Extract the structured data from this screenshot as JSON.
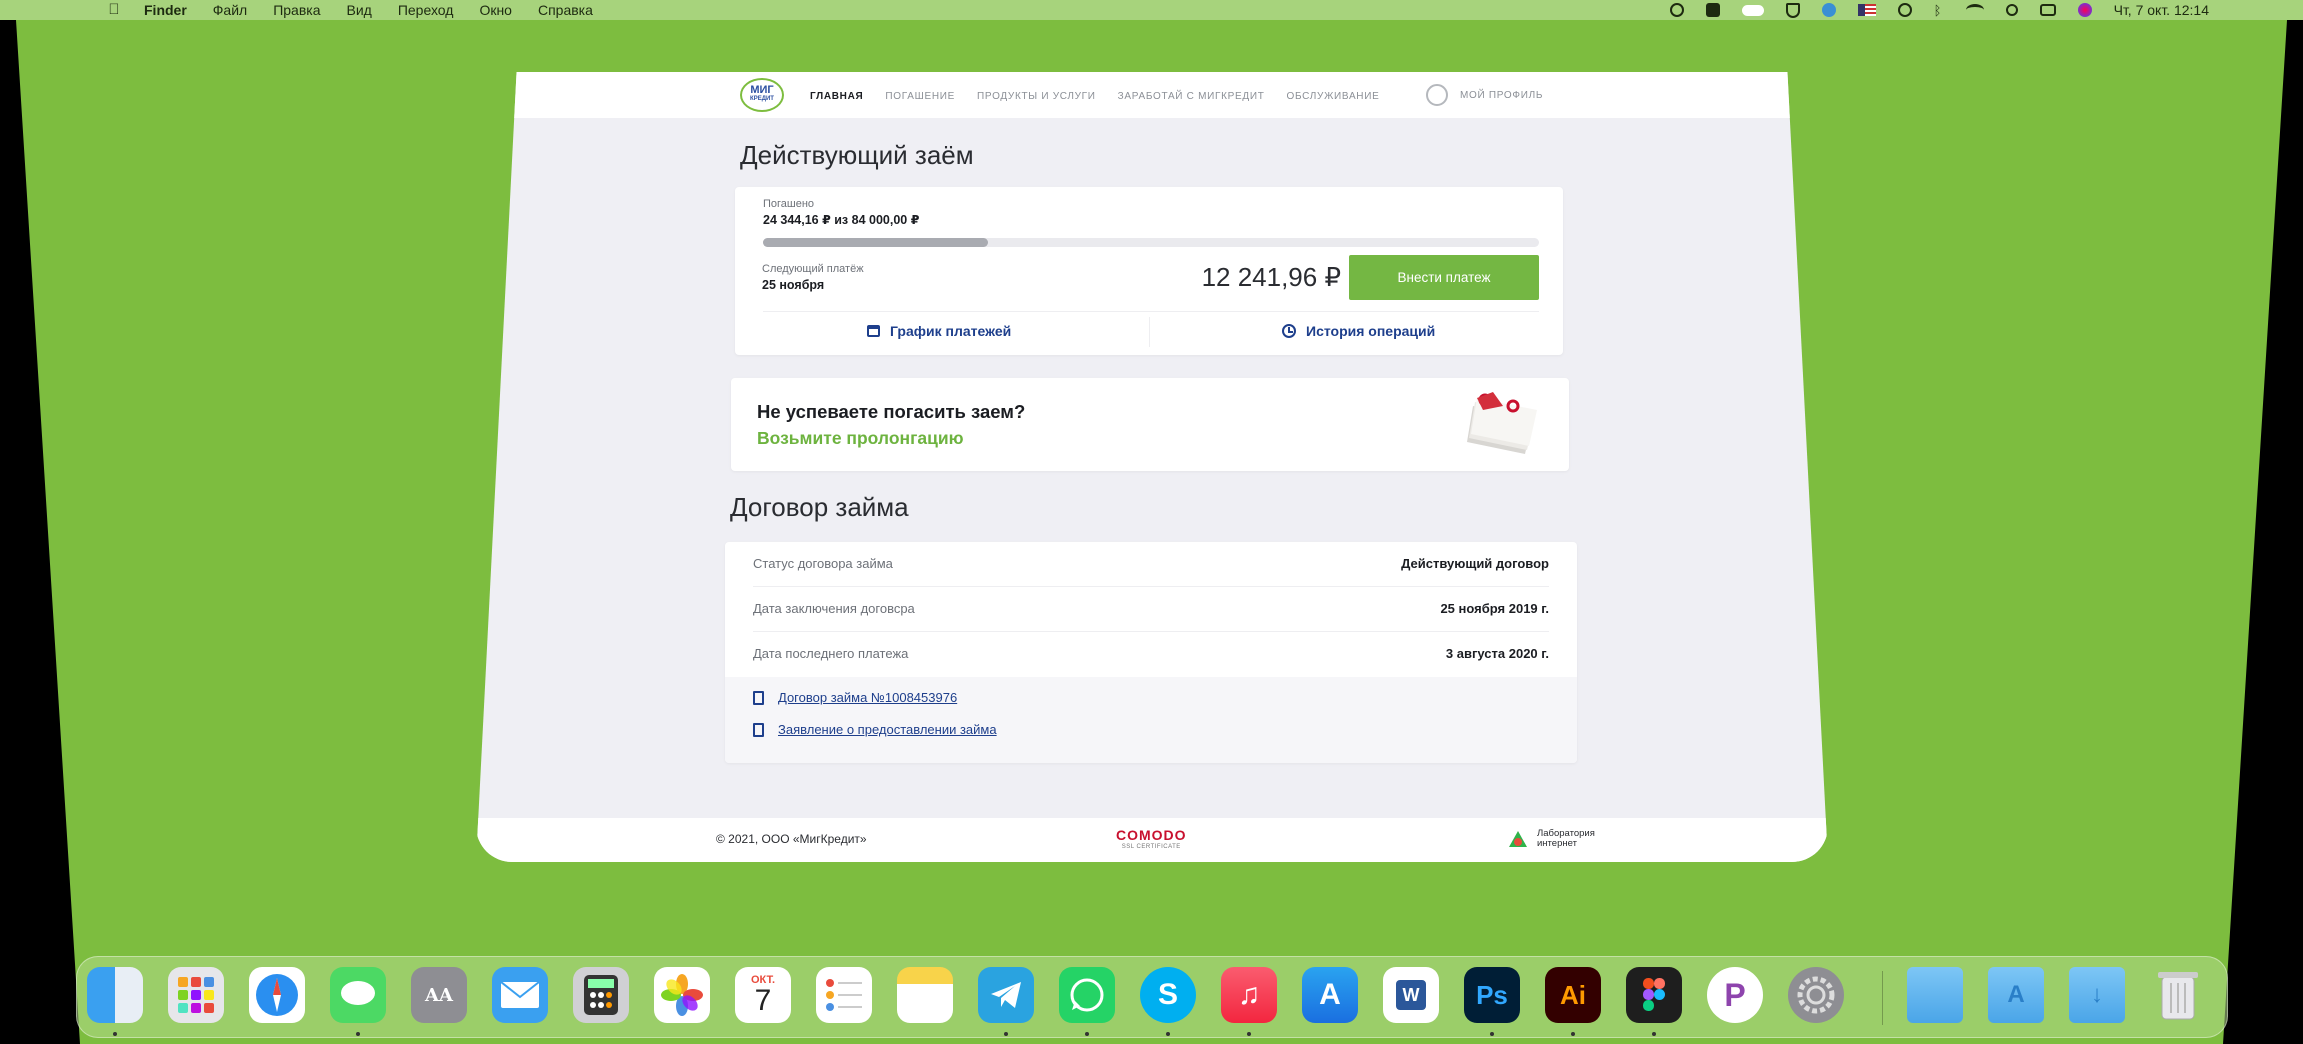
{
  "menubar": {
    "app": "Finder",
    "items": [
      "Файл",
      "Правка",
      "Вид",
      "Переход",
      "Окно",
      "Справка"
    ],
    "clock": "Чт, 7 окт.  12:14"
  },
  "nav": {
    "logo_top": "МИГ",
    "logo_bottom": "КРЕДИТ",
    "links": [
      "ГЛАВНАЯ",
      "ПОГАШЕНИЕ",
      "ПРОДУКТЫ И УСЛУГИ",
      "ЗАРАБОТАЙ С МИГКРЕДИТ",
      "ОБСЛУЖИВАНИЕ"
    ],
    "profile": "МОЙ ПРОФИЛЬ"
  },
  "loan": {
    "title": "Действующий заём",
    "paid_label": "Погашено",
    "paid_value": "24 344,16 ₽ из 84 000,00 ₽",
    "paid_fraction": 0.29,
    "next_label": "Следующий платёж",
    "next_date": "25 ноября",
    "next_amount": "12 241,96 ₽",
    "pay_button": "Внести платеж",
    "schedule_link": "График платежей",
    "history_link": "История операций"
  },
  "promo": {
    "question": "Не успеваете погасить заем?",
    "action": "Возьмите пролонгацию"
  },
  "contract": {
    "title": "Договор займа",
    "rows": [
      {
        "k": "Статус договора займа",
        "v": "Действующий договор"
      },
      {
        "k": "Дата заключения договсра",
        "v": "25 ноября 2019 г."
      },
      {
        "k": "Дата последнего платежа",
        "v": "3 августа 2020 г."
      }
    ],
    "docs": [
      "Договор займа №1008453976",
      "Заявление о предоставлении займа"
    ]
  },
  "footer": {
    "copyright": "© 2021, ООО «МигКредит»",
    "comodo": "COMODO",
    "comodo_sub": "SSL CERTIFICATE",
    "lab_line1": "Лаборатория",
    "lab_line2": "интернет"
  },
  "dock": {
    "calendar_month": "ОКТ.",
    "calendar_day": "7",
    "ps_label": "Ps",
    "ai_label": "Ai",
    "word_label": "W"
  }
}
